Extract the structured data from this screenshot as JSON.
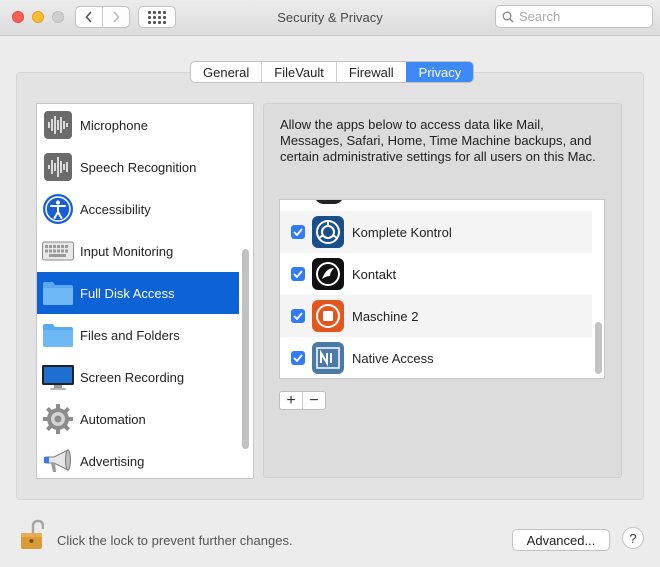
{
  "window": {
    "title": "Security & Privacy"
  },
  "toolbar": {
    "back_icon": "chevron-left-icon",
    "forward_icon": "chevron-right-icon",
    "show_all_icon": "grid-icon",
    "search_placeholder": "Search"
  },
  "tabs": [
    {
      "label": "General",
      "active": false
    },
    {
      "label": "FileVault",
      "active": false
    },
    {
      "label": "Firewall",
      "active": false
    },
    {
      "label": "Privacy",
      "active": true
    }
  ],
  "sidebar": {
    "items": [
      {
        "label": "Microphone",
        "icon": "microphone-icon"
      },
      {
        "label": "Speech Recognition",
        "icon": "speech-recognition-icon"
      },
      {
        "label": "Accessibility",
        "icon": "accessibility-icon"
      },
      {
        "label": "Input Monitoring",
        "icon": "keyboard-icon"
      },
      {
        "label": "Full Disk Access",
        "icon": "folder-icon",
        "selected": true
      },
      {
        "label": "Files and Folders",
        "icon": "folder-icon"
      },
      {
        "label": "Screen Recording",
        "icon": "display-icon"
      },
      {
        "label": "Automation",
        "icon": "gear-icon"
      },
      {
        "label": "Advertising",
        "icon": "megaphone-icon"
      }
    ]
  },
  "main": {
    "description": "Allow the apps below to access data like Mail, Messages, Safari, Home, Time Machine backups, and certain administrative settings for all users on this Mac.",
    "apps": [
      {
        "name": "Komplete Kontrol",
        "checked": true,
        "icon": "komplete-kontrol-icon"
      },
      {
        "name": "Kontakt",
        "checked": true,
        "icon": "kontakt-icon"
      },
      {
        "name": "Maschine 2",
        "checked": true,
        "icon": "maschine-icon"
      },
      {
        "name": "Native Access",
        "checked": true,
        "icon": "native-access-icon"
      }
    ],
    "add_label": "+",
    "remove_label": "−"
  },
  "footer": {
    "lock_text": "Click the lock to prevent further changes.",
    "advanced_label": "Advanced...",
    "help_label": "?"
  },
  "colors": {
    "accent": "#3d89f7",
    "selection": "#0d63d6",
    "checkbox": "#2f7cf6"
  }
}
